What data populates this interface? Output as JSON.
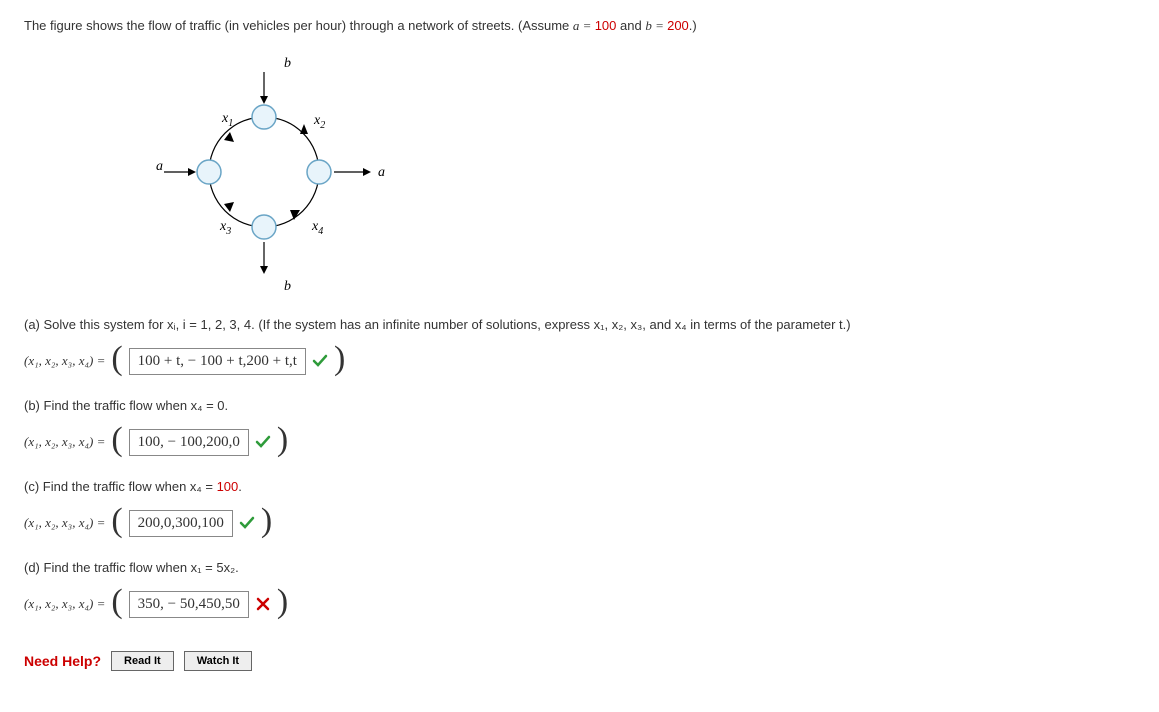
{
  "prompt": {
    "pre": "The figure shows the flow of traffic (in vehicles per hour) through a network of streets. (Assume ",
    "a_eq": "a = ",
    "a_val": "100",
    "mid": " and ",
    "b_eq": "b = ",
    "b_val": "200",
    "post": ".)"
  },
  "diagram": {
    "top": "b",
    "bottom": "b",
    "left": "a",
    "right": "a",
    "x1": "x",
    "x1s": "1",
    "x2": "x",
    "x2s": "2",
    "x3": "x",
    "x3s": "3",
    "x4": "x",
    "x4s": "4"
  },
  "parts": {
    "a": {
      "q": "(a) Solve this system for  xᵢ, i = 1, 2, 3, 4.  (If the system has an infinite number of solutions, express x₁, x₂, x₃, and x₄ in terms of the parameter t.)",
      "lhs": "(x₁, x₂, x₃, x₄) = ",
      "ans": "100 + t, − 100 + t,200 + t,t",
      "mark": "correct"
    },
    "b": {
      "q": "(b) Find the traffic flow when  x₄ = 0.",
      "lhs": "(x₁, x₂, x₃, x₄) = ",
      "ans": "100, − 100,200,0",
      "mark": "correct"
    },
    "c": {
      "q_pre": "(c) Find the traffic flow when  x₄ = ",
      "q_val": "100",
      "q_post": ".",
      "lhs": "(x₁, x₂, x₃, x₄) = ",
      "ans": "200,0,300,100",
      "mark": "correct"
    },
    "d": {
      "q": "(d) Find the traffic flow when  x₁ = 5x₂.",
      "lhs": "(x₁, x₂, x₃, x₄) = ",
      "ans": "350, − 50,450,50",
      "mark": "wrong"
    }
  },
  "help": {
    "label": "Need Help?",
    "read": "Read It",
    "watch": "Watch It"
  }
}
